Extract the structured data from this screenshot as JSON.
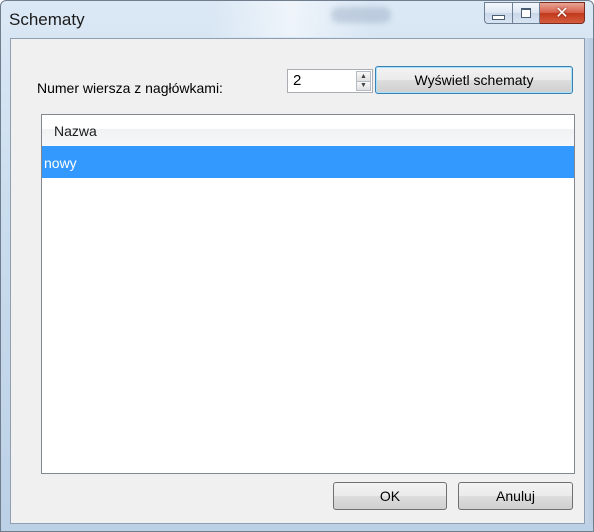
{
  "window": {
    "title": "Schematy"
  },
  "form": {
    "row_label": "Numer wiersza z nagłówkami:",
    "row_value": "2",
    "display_button": "Wyświetl schematy"
  },
  "list": {
    "header": "Nazwa",
    "items": [
      "nowy"
    ]
  },
  "buttons": {
    "ok": "OK",
    "cancel": "Anuluj"
  },
  "icons": {
    "minimize": "minimize-icon",
    "maximize": "maximize-icon",
    "close": "close-icon",
    "spin_up": "triangle-up-icon",
    "spin_down": "triangle-down-icon"
  },
  "colors": {
    "selection": "#3399ff",
    "close_button": "#c2371c"
  }
}
